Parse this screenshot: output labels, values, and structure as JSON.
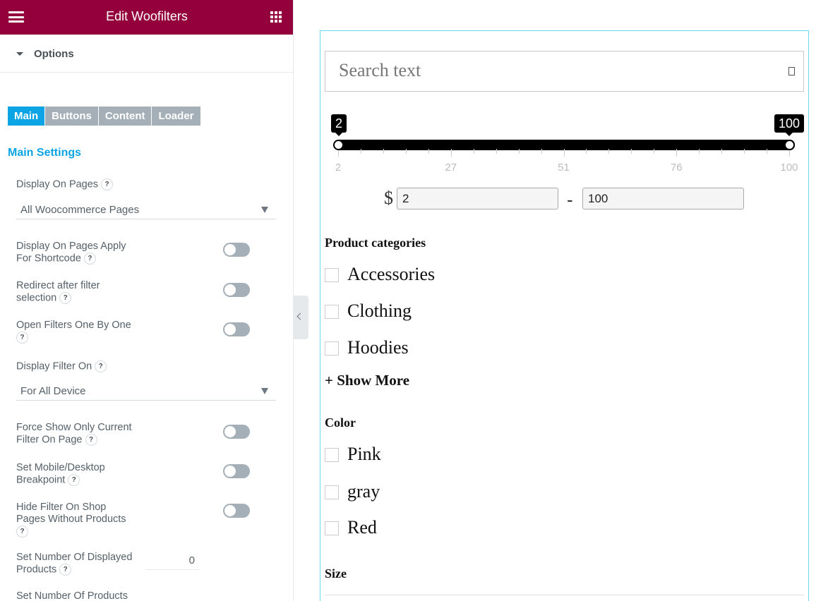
{
  "panel": {
    "title": "Edit Woofilters",
    "options_label": "Options",
    "tabs": [
      {
        "label": "Main",
        "active": true
      },
      {
        "label": "Buttons",
        "active": false
      },
      {
        "label": "Content",
        "active": false
      },
      {
        "label": "Loader",
        "active": false
      }
    ],
    "main_settings": "Main Settings",
    "display_on_pages": {
      "label": "Display On Pages",
      "value": "All Woocommerce Pages"
    },
    "apply_for_shortcode": {
      "line1": "Display On Pages Apply",
      "line2": "For Shortcode"
    },
    "redirect_after": {
      "line1": "Redirect after filter",
      "line2": "selection"
    },
    "open_filters": {
      "line1": "Open Filters One By One"
    },
    "display_filter_on": {
      "label": "Display Filter On",
      "value": "For All Device"
    },
    "force_show": {
      "line1": "Force Show Only Current",
      "line2": "Filter On Page"
    },
    "mobile_breakpoint": {
      "line1": "Set Mobile/Desktop",
      "line2": "Breakpoint"
    },
    "hide_filter": {
      "line1": "Hide Filter On Shop",
      "line2": "Pages Without Products"
    },
    "displayed_products": {
      "line1": "Set Number Of Displayed",
      "line2": "Products",
      "value": "0"
    },
    "number_of_products": {
      "line1": "Set Number Of Products"
    },
    "help_mark": "?"
  },
  "preview": {
    "search_placeholder": "Search text",
    "price": {
      "min": 2,
      "max": 100,
      "min_label": "2",
      "max_label": "100",
      "grid_labels": [
        "2",
        "27",
        "51",
        "76",
        "100"
      ],
      "currency": "$",
      "from_value": "2",
      "to_value": "100",
      "separator": "-"
    },
    "categories_title": "Product categories",
    "categories": [
      "Accessories",
      "Clothing",
      "Hoodies"
    ],
    "show_more": "+ Show More",
    "color_title": "Color",
    "colors": [
      "Pink",
      "gray",
      "Red"
    ],
    "size_title": "Size"
  },
  "colors": {
    "header_bg": "#93003c",
    "tab_active": "#0ca4e4",
    "tab_inactive": "#a4afb7",
    "frame_border": "#71d7f7"
  }
}
